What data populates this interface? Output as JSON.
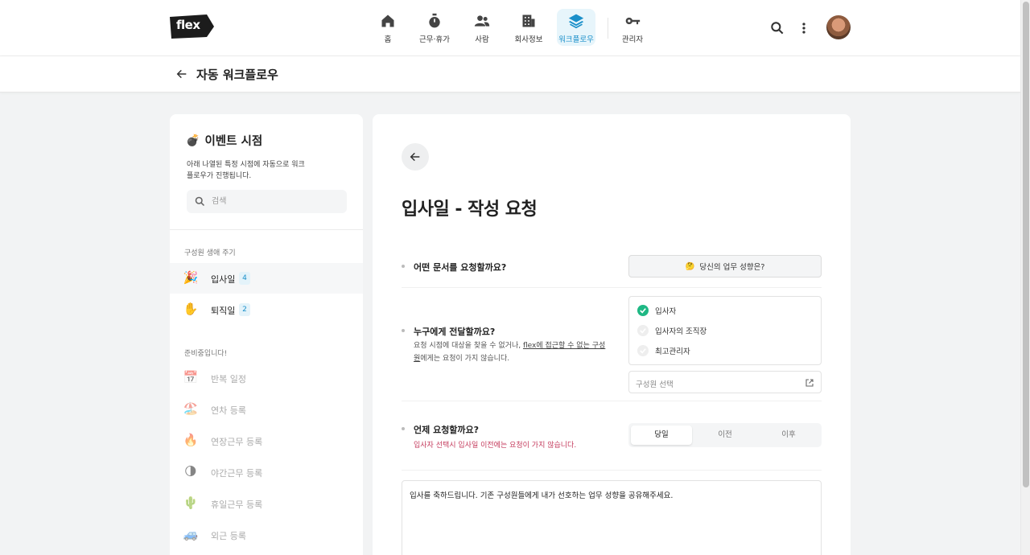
{
  "topnav": {
    "logo_text": "flex",
    "items": [
      {
        "label": "홈",
        "icon": "home-icon"
      },
      {
        "label": "근무·휴가",
        "icon": "stopwatch-icon"
      },
      {
        "label": "사람",
        "icon": "people-icon"
      },
      {
        "label": "회사정보",
        "icon": "building-icon"
      },
      {
        "label": "워크플로우",
        "icon": "layers-icon",
        "active": true
      },
      {
        "label": "관리자",
        "icon": "key-icon"
      }
    ],
    "right_icons": [
      "search-icon",
      "more-vertical-icon",
      "avatar"
    ]
  },
  "subheader": {
    "title": "자동 워크플로우"
  },
  "left_panel": {
    "title": "이벤트 시점",
    "title_emoji": "💣",
    "description": "아래 나열된 특정 시점에 자동으로 워크플로우가 진행됩니다.",
    "search_placeholder": "검색",
    "section1_label": "구성원 생애 주기",
    "section1_items": [
      {
        "emoji": "🎉",
        "label": "입사일",
        "count": "4",
        "active": true
      },
      {
        "emoji": "✋",
        "label": "퇴직일",
        "count": "2"
      }
    ],
    "section2_label": "준비중입니다!",
    "section2_items": [
      {
        "emoji": "📅",
        "label": "반복 일정"
      },
      {
        "emoji": "🏖️",
        "label": "연차 등록"
      },
      {
        "emoji": "🔥",
        "label": "연장근무 등록"
      },
      {
        "emoji": "🌗",
        "label": "야간근무 등록"
      },
      {
        "emoji": "🌵",
        "label": "휴일근무 등록"
      },
      {
        "emoji": "🚙",
        "label": "외근 등록"
      }
    ]
  },
  "main": {
    "title": "입사일 - 작성 요청",
    "q1": {
      "label": "어떤 문서를 요청할까요?",
      "doc_emoji": "🤔",
      "doc_label": "당신의 업무 성향은?"
    },
    "q2": {
      "label": "누구에게 전달할까요?",
      "sub_part1": "요청 시점에 대상을 찾을 수 없거나, ",
      "sub_link": "flex에 접근할 수 없는 구성원",
      "sub_part2": "에게는 요청이 가지 않습니다.",
      "recipients": [
        {
          "label": "입사자",
          "checked": true
        },
        {
          "label": "입사자의 조직장",
          "checked": false
        },
        {
          "label": "최고관리자",
          "checked": false
        }
      ],
      "member_select_placeholder": "구성원 선택"
    },
    "q3": {
      "label": "언제 요청할까요?",
      "warning": "입사자 선택시 입사일 이전에는 요청이 가지 않습니다.",
      "options": [
        "당일",
        "이전",
        "이후"
      ],
      "selected": "당일"
    },
    "message": "입사를 축하드립니다. 기존 구성원들에게 내가 선호하는 업무 성향을 공유해주세요."
  },
  "colors": {
    "accent": "#1a8fc9",
    "active_nav_bg": "#e7f5fb",
    "check_green": "#1fb884",
    "warning_red": "#c43a5c",
    "page_bg": "#f2f3f4"
  }
}
